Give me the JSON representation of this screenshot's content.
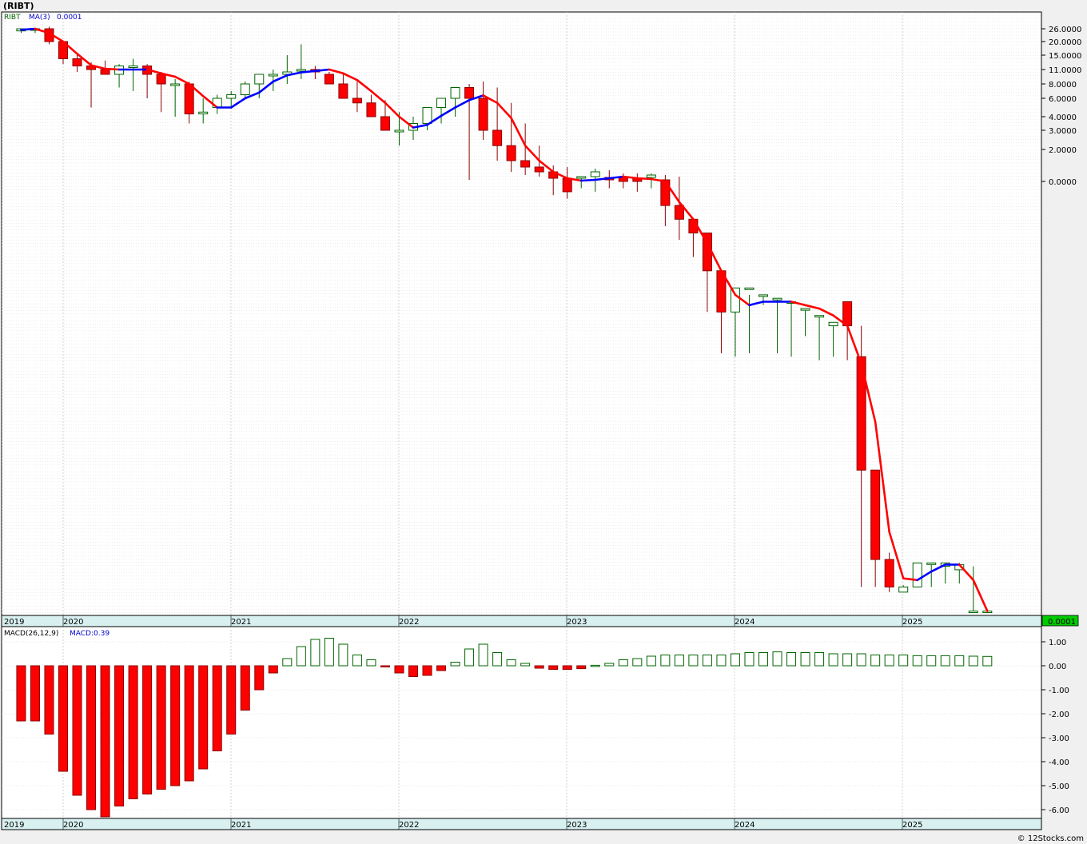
{
  "header": {
    "title": "(RIBT)"
  },
  "price_panel": {
    "legend_symbol": "RIBT",
    "legend_ma": "MA(3)",
    "legend_ma_value": "0.0001",
    "last_price_badge": "0.0001",
    "scale": "log",
    "y_ticks": [
      "26.0000",
      "20.0000",
      "15.0000",
      "11.0000",
      "8.0000",
      "6.0000",
      "4.0000",
      "3.0000",
      "2.0000",
      "0.0000"
    ]
  },
  "macd_panel": {
    "legend_name": "MACD(26,12,9)",
    "legend_value": "MACD:0.39",
    "y_ticks": [
      "1.00",
      "0.00",
      "-1.00",
      "-2.00",
      "-3.00",
      "-4.00",
      "-5.00",
      "-6.00"
    ]
  },
  "x_axis": {
    "years": [
      "2019",
      "2020",
      "2021",
      "2022",
      "2023",
      "2024",
      "2025"
    ]
  },
  "footer": {
    "credit": "© 12Stocks.com"
  },
  "colors": {
    "up": "#ffffff",
    "up_outline": "#006400",
    "down": "#ff0000",
    "ma_up": "#0000ff",
    "ma_down": "#ff0000",
    "badge": "#00cc00",
    "axis_band": "#d8f0f0"
  },
  "chart_data": [
    {
      "type": "candlestick",
      "title": "(RIBT)",
      "x": [
        "2019-10",
        "2019-11",
        "2019-12",
        "2020-01",
        "2020-02",
        "2020-03",
        "2020-04",
        "2020-05",
        "2020-06",
        "2020-07",
        "2020-08",
        "2020-09",
        "2020-10",
        "2020-11",
        "2020-12",
        "2021-01",
        "2021-02",
        "2021-03",
        "2021-04",
        "2021-05",
        "2021-06",
        "2021-07",
        "2021-08",
        "2021-09",
        "2021-10",
        "2021-11",
        "2021-12",
        "2022-01",
        "2022-02",
        "2022-03",
        "2022-04",
        "2022-05",
        "2022-06",
        "2022-07",
        "2022-08",
        "2022-09",
        "2022-10",
        "2022-11",
        "2022-12",
        "2023-01",
        "2023-02",
        "2023-03",
        "2023-04",
        "2023-05",
        "2023-06",
        "2023-07",
        "2023-08",
        "2023-09",
        "2023-10",
        "2023-11",
        "2023-12",
        "2024-01",
        "2024-02",
        "2024-03",
        "2024-04",
        "2024-05",
        "2024-06",
        "2024-07",
        "2024-08",
        "2024-09",
        "2024-10",
        "2024-11",
        "2024-12",
        "2025-01",
        "2025-02",
        "2025-03",
        "2025-04",
        "2025-05",
        "2025-06",
        "2025-07"
      ],
      "open": [
        25,
        26,
        26,
        20,
        14,
        12,
        11,
        10,
        12,
        12,
        10,
        8,
        8,
        4.3,
        5,
        6,
        6.5,
        8,
        10,
        10,
        11,
        11,
        10,
        8,
        6,
        5.5,
        4,
        3,
        3,
        3.5,
        5,
        6,
        7.5,
        6,
        3,
        2.2,
        1.3,
        0.9,
        0.6,
        0.2,
        0.25,
        0.3,
        0.25,
        0.3,
        0.2,
        0.25,
        0.1,
        -0.7,
        -1.1,
        -1.5,
        -2.6,
        -3.8,
        -3.1,
        -3.3,
        -3.4,
        -3.5,
        -3.7,
        -3.9,
        -4.2,
        -3.5,
        -5.1,
        -8.4,
        -11.0,
        -11.95,
        -11.8,
        -11.1,
        -11.2,
        -11.3,
        -12.5,
        -12.5
      ],
      "high": [
        26,
        26.5,
        27,
        20.5,
        15,
        13,
        13.5,
        12.5,
        14,
        12.5,
        10.5,
        9,
        8.5,
        6,
        6.5,
        7,
        8.5,
        10,
        11,
        15,
        19,
        12,
        10.5,
        10,
        8.5,
        6.5,
        5.8,
        4.5,
        4,
        3.5,
        5.5,
        6.5,
        8,
        8.5,
        7.5,
        5.5,
        3.5,
        2.2,
        1,
        0.9,
        0.3,
        0.8,
        0.7,
        0.5,
        0.5,
        0.5,
        0.4,
        0.3,
        -1.1,
        -1.8,
        -2.6,
        -3.8,
        -3.3,
        -3.3,
        -3.4,
        -3.5,
        -3.7,
        -3.9,
        -4.1,
        -3.5,
        -4.2,
        -8.4,
        -10.8,
        -11.75,
        -11.3,
        -11.1,
        -11.1,
        -11.1,
        -11.2,
        -12.5
      ],
      "low": [
        24,
        24,
        19,
        12.5,
        10.5,
        5,
        10,
        7.5,
        7,
        6,
        4.5,
        4,
        3.5,
        3.5,
        4.3,
        5,
        6,
        6,
        7,
        8,
        9,
        9,
        8,
        6,
        4.5,
        4,
        3,
        2.2,
        2.5,
        3,
        3.5,
        4,
        0.1,
        2.5,
        1.3,
        0.6,
        0.4,
        0.3,
        -0.4,
        -0.5,
        -0.2,
        -0.3,
        -0.2,
        -0.2,
        -0.3,
        -0.2,
        -1.3,
        -1.7,
        -2.2,
        -3.8,
        -5.0,
        -5.1,
        -5.0,
        -3.6,
        -5.0,
        -5.1,
        -4.5,
        -5.2,
        -5.1,
        -5.2,
        -11.8,
        -11.8,
        -11.95,
        -11.95,
        -11.8,
        -11.8,
        -11.7,
        -11.7,
        -12.5,
        -12.5
      ],
      "close": [
        26,
        26,
        20,
        14,
        12,
        11,
        10,
        12,
        12,
        10,
        8,
        8,
        4.3,
        4.5,
        6,
        6.5,
        8,
        10,
        10,
        10.5,
        11,
        10.5,
        8,
        6,
        5.5,
        4,
        3,
        3,
        3.5,
        5,
        6,
        7.5,
        6,
        3,
        2.2,
        1.3,
        0.9,
        0.6,
        0.2,
        -0.3,
        0.3,
        0.6,
        0.1,
        0,
        0,
        0.4,
        -0.7,
        -1.1,
        -1.5,
        -2.6,
        -3.8,
        -3.1,
        -3.1,
        -3.3,
        -3.4,
        -3.5,
        -3.7,
        -3.9,
        -4.1,
        -4.2,
        -8.4,
        -11.0,
        -11.8,
        -11.8,
        -11.1,
        -11.1,
        -11.1,
        -11.15,
        -12.5,
        -12.5
      ]
    },
    {
      "type": "line",
      "x": [
        "2019-10",
        "2019-11",
        "2019-12",
        "2020-01",
        "2020-02",
        "2020-03",
        "2020-04",
        "2020-05",
        "2020-06",
        "2020-07",
        "2020-08",
        "2020-09",
        "2020-10",
        "2020-11",
        "2020-12",
        "2021-01",
        "2021-02",
        "2021-03",
        "2021-04",
        "2021-05",
        "2021-06",
        "2021-07",
        "2021-08",
        "2021-09",
        "2021-10",
        "2021-11",
        "2021-12",
        "2022-01",
        "2022-02",
        "2022-03",
        "2022-04",
        "2022-05",
        "2022-06",
        "2022-07",
        "2022-08",
        "2022-09",
        "2022-10",
        "2022-11",
        "2022-12",
        "2023-01",
        "2023-02",
        "2023-03",
        "2023-04",
        "2023-05",
        "2023-06",
        "2023-07",
        "2023-08",
        "2023-09",
        "2023-10",
        "2023-11",
        "2023-12",
        "2024-01",
        "2024-02",
        "2024-03",
        "2024-04",
        "2024-05",
        "2024-06",
        "2024-07",
        "2024-08",
        "2024-09",
        "2024-10",
        "2024-11",
        "2024-12",
        "2025-01",
        "2025-02",
        "2025-03",
        "2025-04",
        "2025-05",
        "2025-06",
        "2025-07"
      ],
      "y": [
        25.5,
        26,
        24,
        20,
        15.5,
        12.2,
        11.2,
        11,
        11,
        11,
        10.2,
        9.5,
        8,
        6.3,
        5,
        5,
        6,
        6.8,
        8.5,
        9.8,
        10.4,
        10.7,
        11,
        10.2,
        8.8,
        7,
        5.5,
        4,
        3.2,
        3.4,
        4.1,
        5,
        5.8,
        6.4,
        5.5,
        3.9,
        2.2,
        1.3,
        0.6,
        0.2,
        0.05,
        0.1,
        0.2,
        0.3,
        0.2,
        0.15,
        0,
        -0.6,
        -1.1,
        -1.8,
        -2.6,
        -3.3,
        -3.6,
        -3.5,
        -3.5,
        -3.5,
        -3.6,
        -3.7,
        -3.9,
        -4.2,
        -5.3,
        -7.0,
        -10.2,
        -11.55,
        -11.6,
        -11.35,
        -11.15,
        -11.15,
        -11.6,
        -12.5
      ]
    },
    {
      "type": "bar",
      "title": "MACD(26,12,9)",
      "x": [
        "2019-10",
        "2019-11",
        "2019-12",
        "2020-01",
        "2020-02",
        "2020-03",
        "2020-04",
        "2020-05",
        "2020-06",
        "2020-07",
        "2020-08",
        "2020-09",
        "2020-10",
        "2020-11",
        "2020-12",
        "2021-01",
        "2021-02",
        "2021-03",
        "2021-04",
        "2021-05",
        "2021-06",
        "2021-07",
        "2021-08",
        "2021-09",
        "2021-10",
        "2021-11",
        "2021-12",
        "2022-01",
        "2022-02",
        "2022-03",
        "2022-04",
        "2022-05",
        "2022-06",
        "2022-07",
        "2022-08",
        "2022-09",
        "2022-10",
        "2022-11",
        "2022-12",
        "2023-01",
        "2023-02",
        "2023-03",
        "2023-04",
        "2023-05",
        "2023-06",
        "2023-07",
        "2023-08",
        "2023-09",
        "2023-10",
        "2023-11",
        "2023-12",
        "2024-01",
        "2024-02",
        "2024-03",
        "2024-04",
        "2024-05",
        "2024-06",
        "2024-07",
        "2024-08",
        "2024-09",
        "2024-10",
        "2024-11",
        "2024-12",
        "2025-01",
        "2025-02",
        "2025-03",
        "2025-04",
        "2025-05",
        "2025-06",
        "2025-07"
      ],
      "values": [
        -2.3,
        -2.3,
        -2.85,
        -4.4,
        -5.4,
        -6.0,
        -6.3,
        -5.85,
        -5.55,
        -5.35,
        -5.15,
        -5.0,
        -4.8,
        -4.3,
        -3.55,
        -2.85,
        -1.85,
        -1.0,
        -0.3,
        0.3,
        0.8,
        1.1,
        1.15,
        0.9,
        0.45,
        0.25,
        -0.05,
        -0.3,
        -0.45,
        -0.4,
        -0.2,
        0.15,
        0.7,
        0.9,
        0.55,
        0.25,
        0.1,
        -0.1,
        -0.15,
        -0.15,
        -0.12,
        0.02,
        0.1,
        0.25,
        0.3,
        0.4,
        0.45,
        0.45,
        0.45,
        0.45,
        0.45,
        0.5,
        0.55,
        0.55,
        0.58,
        0.55,
        0.55,
        0.55,
        0.5,
        0.5,
        0.5,
        0.45,
        0.45,
        0.45,
        0.42,
        0.42,
        0.42,
        0.42,
        0.4,
        0.39
      ],
      "ylim": [
        -6.4,
        1.4
      ]
    }
  ]
}
